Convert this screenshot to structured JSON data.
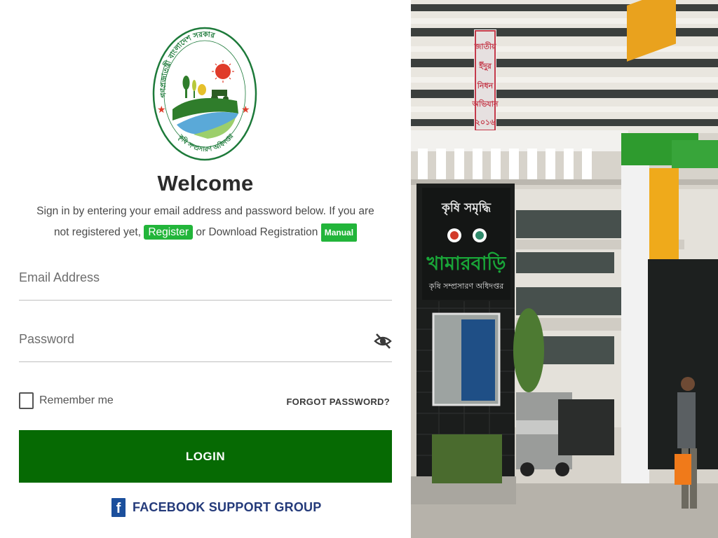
{
  "logo": {
    "icon": "government-seal-logo",
    "alt": "Department of Agricultural Extension logo"
  },
  "welcome": {
    "title": "Welcome",
    "subtitle_part1": "Sign in by entering your email address and password below. If you are not registered yet,",
    "register_link": "Register",
    "subtitle_part2": "or Download Registration",
    "manual_link": "Manual"
  },
  "form": {
    "email_placeholder": "Email Address",
    "email_value": "",
    "password_placeholder": "Password",
    "password_value": "",
    "remember_label": "Remember me",
    "remember_checked": false,
    "forgot_label": "FORGOT PASSWORD?",
    "login_label": "LOGIN"
  },
  "support": {
    "facebook_label": "FACEBOOK SUPPORT GROUP",
    "icon": "facebook-icon"
  },
  "photo": {
    "alt": "Khamarbari Department of Agricultural Extension building entrance",
    "sign_top": "কৃষি সমৃদ্ধি",
    "sign_main": "খামারবাড়ি",
    "sign_sub": "কৃষি সম্প্রসারণ অধিদপ্তর",
    "banner_text": "জাতীয় ইঁদুর নিধন অভিযান ২০১৬"
  },
  "colors": {
    "primary_green": "#066a03",
    "link_green": "#22b53a",
    "facebook_blue": "#1b4f9c"
  }
}
